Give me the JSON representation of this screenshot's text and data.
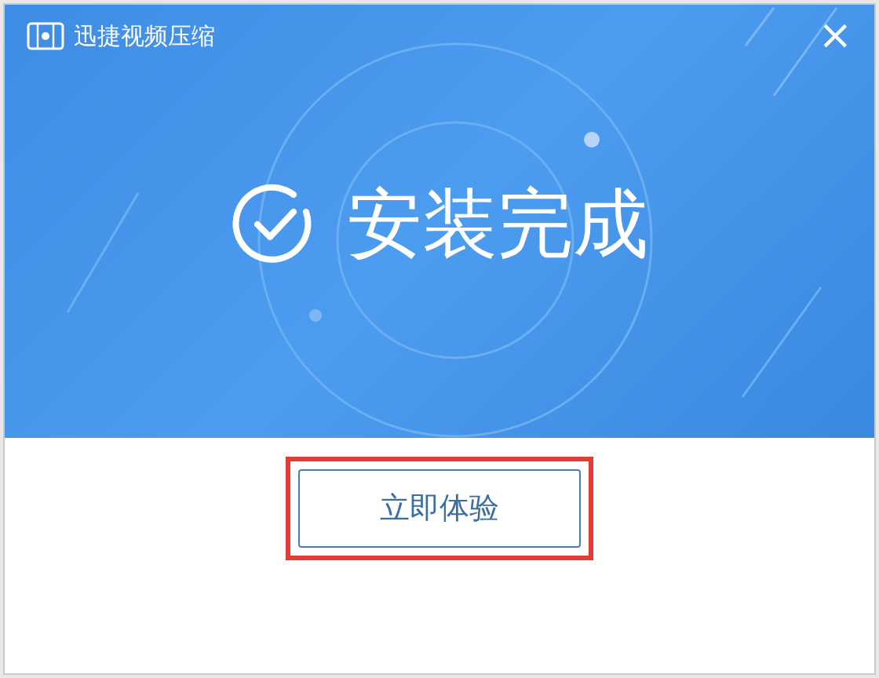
{
  "window": {
    "title": "迅捷视频压缩",
    "close": "×"
  },
  "banner": {
    "message": "安装完成"
  },
  "button": {
    "label": "立即体验",
    "highlighted": true
  }
}
